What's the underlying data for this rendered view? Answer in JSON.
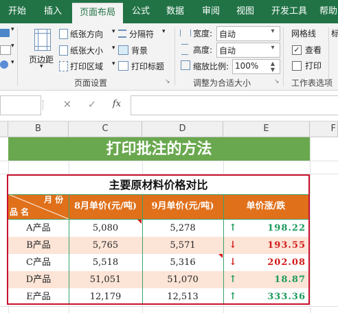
{
  "ribbon_tabs": [
    "开始",
    "插入",
    "页面布局",
    "公式",
    "数据",
    "审阅",
    "视图",
    "开发工具",
    "帮助"
  ],
  "active_tab": "页面布局",
  "ribbon": {
    "page_setup": {
      "margins": "页边距",
      "orientation": "纸张方向",
      "size": "纸张大小",
      "print_area": "打印区域",
      "breaks": "分隔符",
      "background": "背景",
      "print_titles": "打印标题",
      "group_label": "页面设置"
    },
    "scale_to_fit": {
      "width_label": "宽度:",
      "width_value": "自动",
      "height_label": "高度:",
      "height_value": "自动",
      "scale_label": "缩放比例:",
      "scale_value": "100%",
      "group_label": "调整为合适大小"
    },
    "sheet_options": {
      "gridlines_label": "网格线",
      "view_label": "查看",
      "view_checked": true,
      "print_label": "打印",
      "print_checked": false,
      "group_label": "工作表选项",
      "extra_label": "标"
    }
  },
  "formula_bar": {
    "fx_label": "fx",
    "cancel_icon": "✕",
    "enter_icon": "✓"
  },
  "columns": [
    "B",
    "C",
    "D",
    "E",
    "F"
  ],
  "sheet": {
    "banner": "打印批注的方法",
    "table_title": "主要原材料价格对比",
    "diag_header_top": "月 份",
    "diag_header_bottom": "品 名",
    "headers": [
      "8月单价(元/吨)",
      "9月单价(元/吨)",
      "单价涨/跌"
    ],
    "rows": [
      {
        "name": "A产品",
        "aug": "5,080",
        "sep": "5,278",
        "change": "198.22",
        "direction": "up",
        "aug_comment": true,
        "sep_comment": false
      },
      {
        "name": "B产品",
        "aug": "5,765",
        "sep": "5,571",
        "change": "193.55",
        "direction": "down",
        "aug_comment": false,
        "sep_comment": false
      },
      {
        "name": "C产品",
        "aug": "5,518",
        "sep": "5,316",
        "change": "202.08",
        "direction": "down",
        "aug_comment": false,
        "sep_comment": true
      },
      {
        "name": "D产品",
        "aug": "51,051",
        "sep": "51,070",
        "change": "18.87",
        "direction": "up",
        "aug_comment": false,
        "sep_comment": false
      },
      {
        "name": "E产品",
        "aug": "12,179",
        "sep": "12,513",
        "change": "333.36",
        "direction": "up",
        "aug_comment": false,
        "sep_comment": false
      }
    ]
  },
  "colors": {
    "ribbon_green": "#217346",
    "banner_green": "#6aa84f",
    "header_orange": "#e0701a",
    "row_tint": "#fce4d6",
    "border_red": "#c8102e",
    "up_green": "#1a9a5a",
    "down_red": "#d21a1a"
  }
}
